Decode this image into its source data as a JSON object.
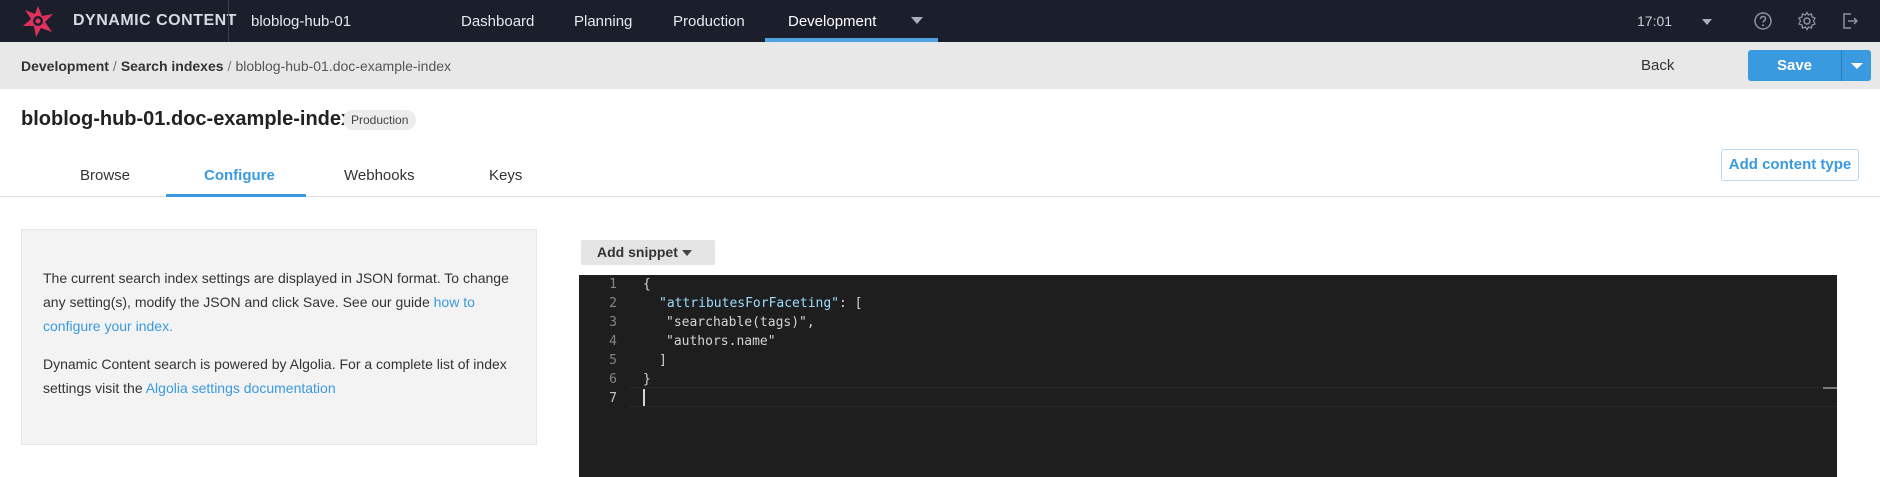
{
  "app": {
    "brand": "DYNAMIC CONTENT",
    "hub": "bloblog-hub-01",
    "nav": {
      "dashboard": "Dashboard",
      "planning": "Planning",
      "production": "Production",
      "development": "Development"
    },
    "time": "17:01"
  },
  "breadcrumb": {
    "items": [
      "Development",
      "Search indexes",
      "bloblog-hub-01.doc-example-index"
    ],
    "separator": "/"
  },
  "actions": {
    "back": "Back",
    "save": "Save",
    "add_content_type": "Add content type"
  },
  "page": {
    "title": "bloblog-hub-01.doc-example-index",
    "badge": "Production"
  },
  "tabs": {
    "browse": "Browse",
    "configure": "Configure",
    "webhooks": "Webhooks",
    "keys": "Keys"
  },
  "info": {
    "p1_text": "The current search index settings are displayed in JSON format. To change any setting(s), modify the JSON and click Save. See our guide ",
    "p1_link": "how to configure your index.",
    "p2_text": "Dynamic Content search is powered by Algolia. For a complete list of index settings visit the ",
    "p2_link": "Algolia settings documentation"
  },
  "editor": {
    "add_snippet": "Add snippet",
    "line_numbers": [
      "1",
      "2",
      "3",
      "4",
      "5",
      "6",
      "7"
    ],
    "lines": {
      "l1": "{",
      "l2_key": "\"attributesForFaceting\"",
      "l2_rest": ": [",
      "l3": "\"searchable(tags)\",",
      "l4": "\"authors.name\"",
      "l5": "]",
      "l6": "}"
    }
  },
  "colors": {
    "nav_bg": "#1b1f2b",
    "accent": "#3a9ae0",
    "editor_bg": "#1e1e1e"
  }
}
